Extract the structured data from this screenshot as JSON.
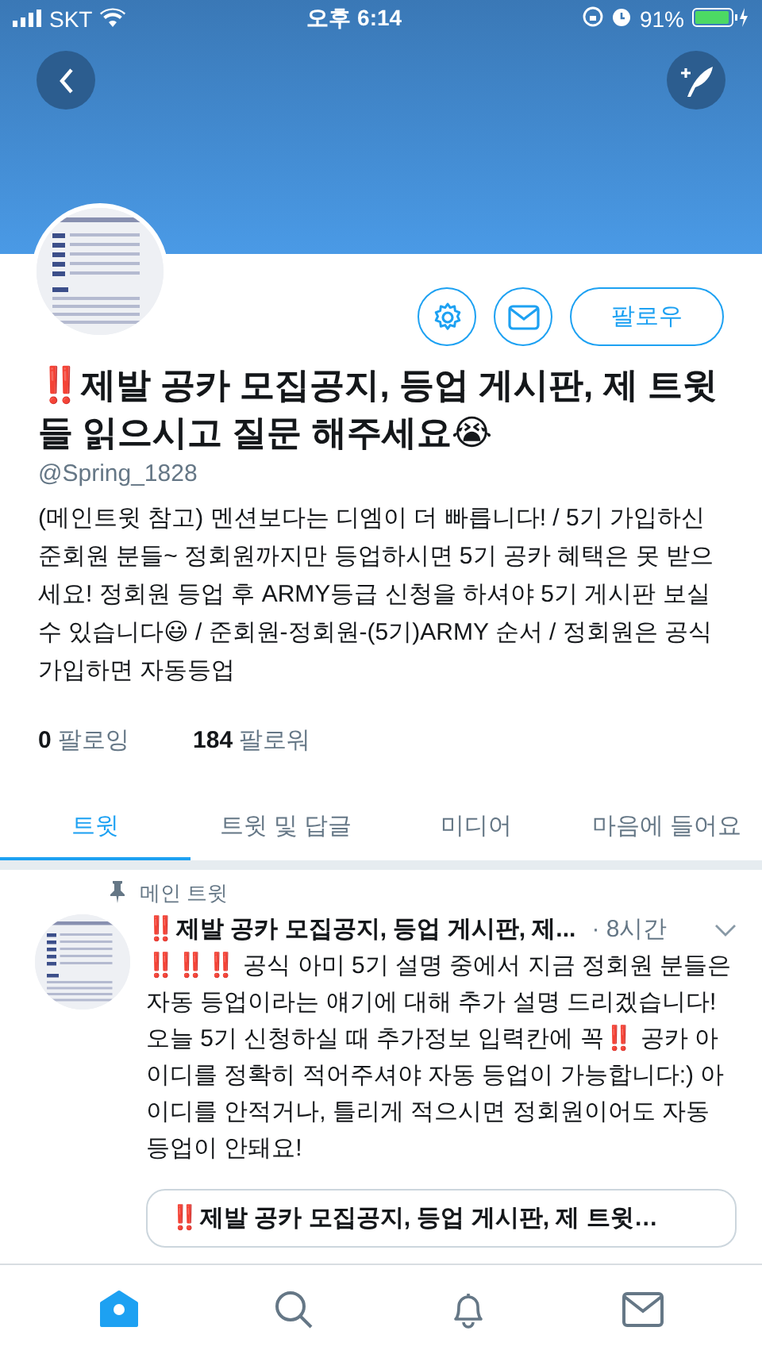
{
  "status_bar": {
    "carrier": "SKT",
    "time": "오후 6:14",
    "battery": "91%"
  },
  "profile": {
    "name": "‼️제발 공카 모집공지, 등업 게시판, 제 트윗들 읽으시고 질문 해주세요😭",
    "handle": "@Spring_1828",
    "bio": "(메인트윗 참고) 멘션보다는 디엠이 더 빠릅니다! / 5기 가입하신 준회원 분들~ 정회원까지만 등업하시면 5기 공카 혜택은 못 받으세요! 정회원 등업 후 ARMY등급 신청을 하셔야 5기 게시판 보실수 있습니다😃 / 준회원-정회원-(5기)ARMY 순서 / 정회원은 공식 가입하면 자동등업",
    "follow_button": "팔로우",
    "stats": [
      {
        "count": "0",
        "label": "팔로잉"
      },
      {
        "count": "184",
        "label": "팔로워"
      }
    ]
  },
  "tabs": [
    {
      "label": "트윗",
      "selected": true
    },
    {
      "label": "트윗 및 답글",
      "selected": false
    },
    {
      "label": "미디어",
      "selected": false
    },
    {
      "label": "마음에 들어요",
      "selected": false
    }
  ],
  "pinned_tweet": {
    "pin_label": "메인 트윗",
    "author": "‼️제발 공카 모집공지, 등업 게시판, 제...",
    "time": "· 8시간",
    "text": "‼️‼️‼️ 공식 아미 5기 설명 중에서 지금 정회원 분들은 자동 등업이라는 얘기에 대해 추가 설명 드리겠습니다! 오늘 5기 신청하실 때 추가정보 입력칸에 꼭‼️ 공카 아이디를 정확히 적어주셔야 자동 등업이 가능합니다:) 아이디를 안적거나, 틀리게 적으시면 정회원이어도 자동 등업이 안돼요!",
    "quote_title": "‼️제발 공카 모집공지, 등업 게시판, 제 트윗…"
  },
  "bottom_nav": [
    {
      "kind": "home",
      "selected": true
    },
    {
      "kind": "search",
      "selected": false
    },
    {
      "kind": "notifications",
      "selected": false
    },
    {
      "kind": "messages",
      "selected": false
    }
  ]
}
